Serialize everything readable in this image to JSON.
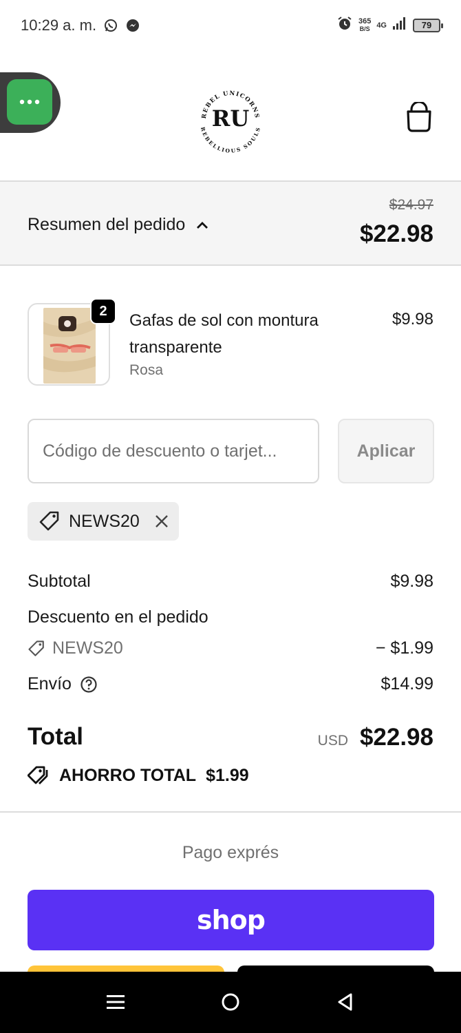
{
  "status_bar": {
    "time": "10:29 a. m.",
    "net_speed_value": "365",
    "net_speed_unit": "B/S",
    "network": "4G",
    "battery": "79"
  },
  "header": {
    "logo_initials": "RU",
    "logo_top_text": "REBEL UNICORNS",
    "logo_bottom_text": "REBELLIOUS SOULS"
  },
  "summary": {
    "toggle_label": "Resumen del pedido",
    "original_price": "$24.97",
    "price": "$22.98"
  },
  "product": {
    "quantity": "2",
    "name": "Gafas de sol con montura transparente",
    "variant": "Rosa",
    "price": "$9.98"
  },
  "discount": {
    "placeholder": "Código de descuento o tarjet...",
    "apply_label": "Aplicar",
    "applied_code": "NEWS20"
  },
  "totals": {
    "subtotal_label": "Subtotal",
    "subtotal_value": "$9.98",
    "discount_label": "Descuento en el pedido",
    "discount_code": "NEWS20",
    "discount_value": "− $1.99",
    "shipping_label": "Envío",
    "shipping_value": "$14.99",
    "total_label": "Total",
    "currency": "USD",
    "total_value": "$22.98",
    "savings_label": "AHORRO TOTAL",
    "savings_value": "$1.99"
  },
  "express": {
    "label": "Pago exprés",
    "shop_pay_label": "shop"
  },
  "colors": {
    "shop_pay": "#5a31f4",
    "floating_button": "#3cb059",
    "paypal": "#ffc439"
  }
}
